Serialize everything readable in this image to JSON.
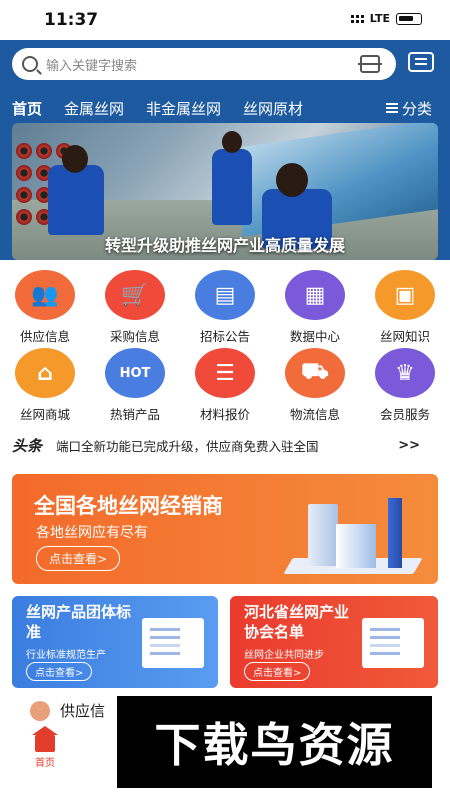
{
  "status": {
    "time": "11:37",
    "network": "LTE"
  },
  "search": {
    "placeholder": "输入关键字搜索"
  },
  "nav": {
    "tabs": [
      "首页",
      "金属丝网",
      "非金属丝网",
      "丝网原材"
    ],
    "category_label": "分类"
  },
  "banner": {
    "caption": "转型升级助推丝网产业高质量发展"
  },
  "grid": {
    "items": [
      {
        "label": "供应信息",
        "icon": "users-icon",
        "color": "#f26b3a"
      },
      {
        "label": "采购信息",
        "icon": "cart-icon",
        "color": "#f04a3a"
      },
      {
        "label": "招标公告",
        "icon": "briefcase-icon",
        "color": "#4a7de0"
      },
      {
        "label": "数据中心",
        "icon": "building-icon",
        "color": "#7a5ad8"
      },
      {
        "label": "丝网知识",
        "icon": "radio-icon",
        "color": "#f59a2a"
      },
      {
        "label": "丝网商城",
        "icon": "store-icon",
        "color": "#f59a2a"
      },
      {
        "label": "热销产品",
        "icon": "hot-icon",
        "color": "#4a7de0"
      },
      {
        "label": "材料报价",
        "icon": "calendar-icon",
        "color": "#f04a3a"
      },
      {
        "label": "物流信息",
        "icon": "truck-icon",
        "color": "#f26b3a"
      },
      {
        "label": "会员服务",
        "icon": "crown-icon",
        "color": "#7a5ad8"
      }
    ]
  },
  "ticker": {
    "logo": "头条",
    "text": "端口全新功能已完成升级，供应商免费入驻全国",
    "more": ">>"
  },
  "promo": {
    "title": "全国各地丝网经销商",
    "subtitle": "各地丝网应有尽有",
    "button": "点击查看>"
  },
  "cards": [
    {
      "title": "丝网产品团体标准",
      "subtitle": "行业标准规范生产",
      "button": "点击查看>"
    },
    {
      "title": "河北省丝网产业协会名单",
      "subtitle": "丝网企业共同进步",
      "button": "点击查看>"
    }
  ],
  "list": {
    "heading": "供应信"
  },
  "tabbar": {
    "home": "首页"
  },
  "watermark": "下载鸟资源"
}
